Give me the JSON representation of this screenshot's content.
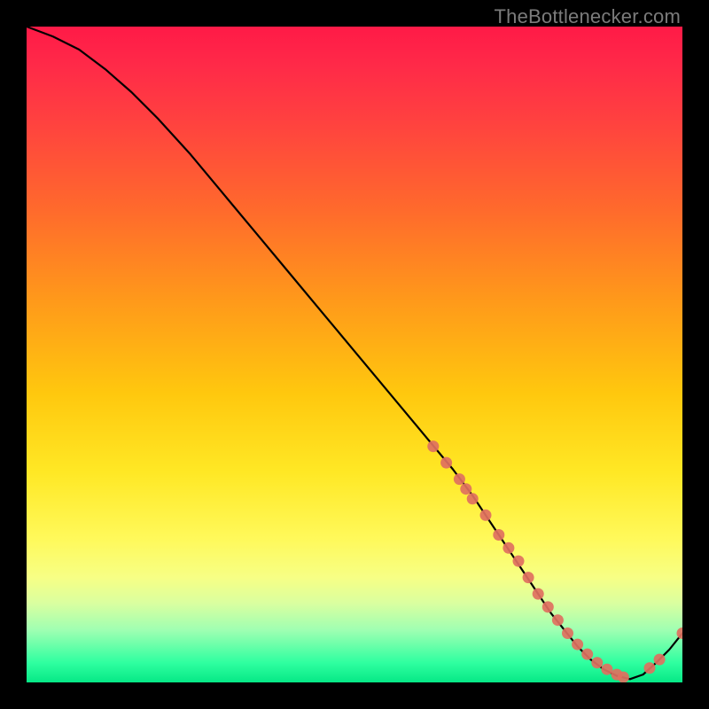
{
  "watermark": {
    "text": "TheBottlenecker.com"
  },
  "colors": {
    "background": "#000000",
    "curve": "#000000",
    "marker": "#e07060",
    "gradient_stops": [
      "#ff1a47",
      "#ff2a48",
      "#ff4040",
      "#ff6a2c",
      "#ff9a1a",
      "#ffc80e",
      "#ffe825",
      "#fff95a",
      "#f7ff85",
      "#d9ffa0",
      "#9fffb2",
      "#2fffa0",
      "#06e886"
    ]
  },
  "chart_data": {
    "type": "line",
    "title": "",
    "xlabel": "",
    "ylabel": "",
    "xlim": [
      0,
      100
    ],
    "ylim": [
      0,
      100
    ],
    "note": "Axes are unlabeled in the source image; x/y are normalized 0–100 from the plot box.",
    "series": [
      {
        "name": "curve",
        "x": [
          0,
          4,
          8,
          12,
          16,
          20,
          25,
          30,
          35,
          40,
          45,
          50,
          55,
          60,
          65,
          68,
          70,
          72,
          74,
          76,
          78,
          80,
          82,
          84,
          86,
          88,
          90,
          92,
          94,
          96,
          98,
          100
        ],
        "y": [
          100,
          98.5,
          96.5,
          93.5,
          90,
          86,
          80.5,
          74.5,
          68.5,
          62.5,
          56.5,
          50.5,
          44.5,
          38.5,
          32.5,
          28.5,
          25.5,
          22.5,
          19.5,
          16.5,
          13.5,
          10.5,
          8,
          5.5,
          3.5,
          2,
          1,
          0.5,
          1.2,
          3,
          5,
          7.5
        ]
      }
    ],
    "markers": {
      "name": "highlight-dots",
      "x": [
        62,
        64,
        66,
        67,
        68,
        70,
        72,
        73.5,
        75,
        76.5,
        78,
        79.5,
        81,
        82.5,
        84,
        85.5,
        87,
        88.5,
        90,
        91,
        95,
        96.5,
        100
      ],
      "y": [
        36,
        33.5,
        31,
        29.5,
        28,
        25.5,
        22.5,
        20.5,
        18.5,
        16,
        13.5,
        11.5,
        9.5,
        7.5,
        5.8,
        4.3,
        3,
        2,
        1.2,
        0.8,
        2.2,
        3.5,
        7.5
      ]
    }
  }
}
